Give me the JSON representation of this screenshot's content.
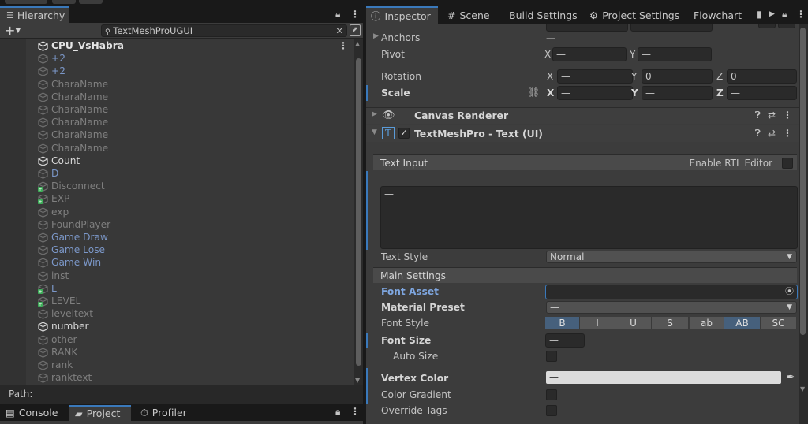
{
  "hierarchy": {
    "tab_label": "Hierarchy",
    "search_value": "TextMeshProUGUI",
    "root": "CPU_VsHabra",
    "items": [
      {
        "label": "+2",
        "color": "blue"
      },
      {
        "label": "+2",
        "color": "blue"
      },
      {
        "label": "CharaName",
        "color": "gray"
      },
      {
        "label": "CharaName",
        "color": "gray"
      },
      {
        "label": "CharaName",
        "color": "gray"
      },
      {
        "label": "CharaName",
        "color": "gray"
      },
      {
        "label": "CharaName",
        "color": "gray"
      },
      {
        "label": "CharaName",
        "color": "gray"
      },
      {
        "label": "Count",
        "color": "white"
      },
      {
        "label": "D",
        "color": "blue"
      },
      {
        "label": "Disconnect",
        "color": "gray"
      },
      {
        "label": "EXP",
        "color": "gray"
      },
      {
        "label": "exp",
        "color": "gray"
      },
      {
        "label": "FoundPlayer",
        "color": "gray"
      },
      {
        "label": "Game Draw",
        "color": "blue"
      },
      {
        "label": "Game Lose",
        "color": "blue"
      },
      {
        "label": "Game Win",
        "color": "blue"
      },
      {
        "label": "inst",
        "color": "gray"
      },
      {
        "label": "L",
        "color": "blue"
      },
      {
        "label": "LEVEL",
        "color": "gray"
      },
      {
        "label": "leveltext",
        "color": "gray"
      },
      {
        "label": "number",
        "color": "white"
      },
      {
        "label": "other",
        "color": "gray"
      },
      {
        "label": "RANK",
        "color": "gray"
      },
      {
        "label": "rank",
        "color": "gray"
      },
      {
        "label": "ranktext",
        "color": "gray"
      }
    ],
    "path_label": "Path:"
  },
  "bottom_tabs": {
    "console": "Console",
    "project": "Project",
    "profiler": "Profiler"
  },
  "inspector_tabs": {
    "inspector": "Inspector",
    "scene": "Scene",
    "build": "Build Settings",
    "project_settings": "Project Settings",
    "flowchart": "Flowchart"
  },
  "transform": {
    "anchors": "Anchors",
    "anchors_value": "—",
    "pivot": "Pivot",
    "pivot_x": "—",
    "pivot_y": "—",
    "rotation": "Rotation",
    "rot_x": "—",
    "rot_y": "0",
    "rot_z": "0",
    "scale": "Scale",
    "scale_x": "—",
    "scale_y": "—",
    "scale_z": "—",
    "axis_x": "X",
    "axis_y": "Y",
    "axis_z": "Z"
  },
  "components": {
    "canvas_renderer": "Canvas Renderer",
    "tmp_text": "TextMeshPro - Text (UI)"
  },
  "tmp": {
    "text_input": "Text Input",
    "enable_rtl": "Enable RTL Editor",
    "text_value": "—",
    "text_style_label": "Text Style",
    "text_style_value": "Normal",
    "main_settings": "Main Settings",
    "font_asset_label": "Font Asset",
    "font_asset_value": "—",
    "material_preset_label": "Material Preset",
    "material_preset_value": "—",
    "font_style_label": "Font Style",
    "font_style_buttons": [
      "B",
      "I",
      "U",
      "S",
      "ab",
      "AB",
      "SC"
    ],
    "font_size_label": "Font Size",
    "font_size_value": "—",
    "auto_size_label": "Auto Size",
    "vertex_color_label": "Vertex Color",
    "vertex_color_value": "—",
    "color_gradient_label": "Color Gradient",
    "override_tags_label": "Override Tags"
  },
  "colors": {
    "accent": "#3a79bb",
    "panel": "#383838",
    "label_blue": "#7b97c8",
    "field_bg": "#2a2a2a"
  }
}
